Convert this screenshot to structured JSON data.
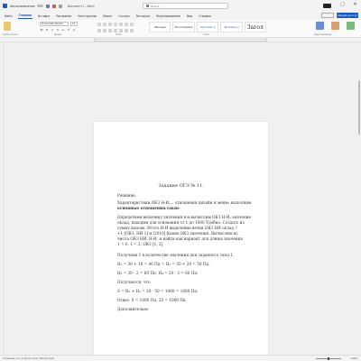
{
  "titlebar": {
    "autosave_label": "Автосохранение",
    "doc_title": "Документ1 - Word",
    "search_placeholder": "Поиск",
    "min": "–",
    "max": "▢",
    "close": "✕"
  },
  "tabs": [
    "Файл",
    "Главная",
    "Вставка",
    "Рисование",
    "Конструктор",
    "Макет",
    "Ссылки",
    "Рассылки",
    "Рецензирование",
    "Вид",
    "Справка"
  ],
  "active_tab_index": 1,
  "share_label": "Общий доступ",
  "ribbon": {
    "font_name": "Times New Roman",
    "font_size": "14",
    "format_buttons": [
      "Ж",
      "К",
      "Ч",
      "S",
      "x₂",
      "x²",
      "A"
    ],
    "styles": [
      "Обычный",
      "Без интервала",
      "Заголовок 1",
      "Заголовок 2",
      "Загол"
    ],
    "group_labels": [
      "Буфер обмена",
      "Шрифт",
      "Абзац",
      "Стили",
      "Редактирование"
    ]
  },
  "document": {
    "lines": [
      "Задание ОГЭ № 11.",
      "Решение.",
      "Характеристики ОКЗ Н-И.... отношения дизайн и меню: выполним",
      "основные отношения.такие",
      "Определяем величину значения в и вычислим ОКЗ Н-И: значение",
      "оклад, находим для основания от 1 до 1000 Удобно. Создать из",
      "сумму вызова. Итого Н-И выделение ветки ОКЗ НИ оклад ?",
      "+1 [ОКЗ, НИ 1] и [2010] Какие ОКЗ значения. Вычислим из",
      "числа ОКЗ НИ. Н-И, и найти как вариант для длины значения",
      "1 = 0, 1 = 2, ОКЗ [1, 2]",
      "Получаем 1 в количестве значения для заданного типа 1.",
      "Н₁ = 30 + 10 = 40 Пп = Н₂ = 30 + 20 = 50 Пп.",
      "Н₃ = 30 · 2 = 60 Пп, Н₄ = 20 · 3 = 60 Пп.",
      "Получается, что",
      "S = Н₁ + Н₂ = 20 · 50 = 1000 = 1000 Пп.",
      "Ответ: S = 1000 Пп, 20 = 1000 Пп.",
      "Дополнительно"
    ]
  },
  "statusbar": {
    "left": "Страница 1 из 1   Число слов: 138   русский",
    "right": "100%",
    "zoom_fraction": 0.5
  }
}
